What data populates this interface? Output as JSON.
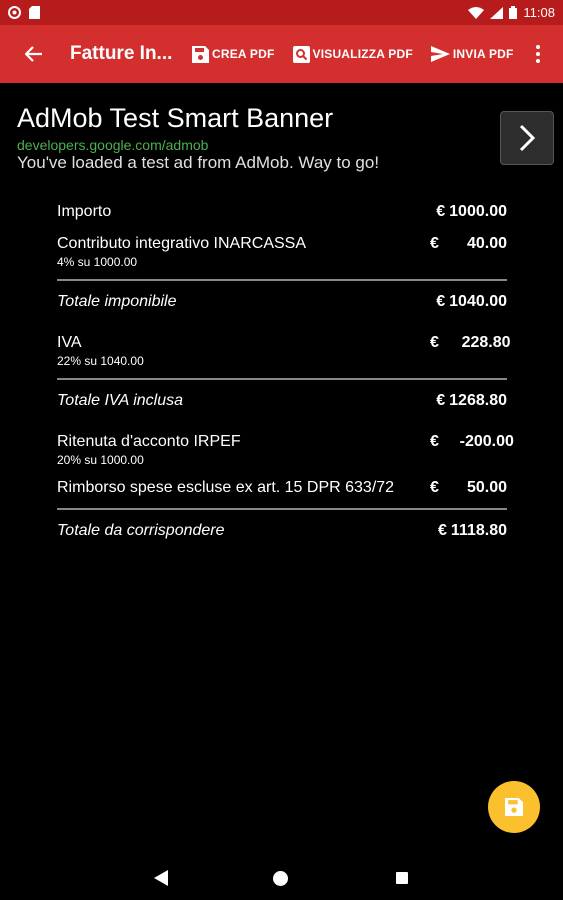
{
  "status_bar": {
    "time": "11:08"
  },
  "toolbar": {
    "title": "Fatture In...",
    "actions": [
      {
        "label": "CREA PDF",
        "icon": "save-icon"
      },
      {
        "label": "VISUALIZZA PDF",
        "icon": "search-icon"
      },
      {
        "label": "INVIA PDF",
        "icon": "send-icon"
      }
    ]
  },
  "ad": {
    "title": "AdMob Test Smart Banner",
    "url": "developers.google.com/admob",
    "text": "You've loaded a test ad from AdMob. Way to go!"
  },
  "invoice": {
    "currency": "€",
    "rows": [
      {
        "label": "Importo",
        "amount": "1000.00"
      },
      {
        "label": "Contributo integrativo INARCASSA",
        "sub": "4% su 1000.00",
        "amount": "40.00"
      },
      {
        "label": "Totale imponibile",
        "amount": "1040.00"
      },
      {
        "label": "IVA",
        "sub": "22% su 1040.00",
        "amount": "228.80"
      },
      {
        "label": "Totale IVA inclusa",
        "amount": "1268.80"
      },
      {
        "label": "Ritenuta d'acconto IRPEF",
        "sub": "20% su 1000.00",
        "amount": "-200.00"
      },
      {
        "label": "Rimborso spese escluse ex art. 15 DPR 633/72",
        "amount": "50.00"
      },
      {
        "label": "Totale da corrispondere",
        "amount": "1118.80"
      }
    ]
  },
  "colors": {
    "toolbar": "#d32f2f",
    "status_bar": "#b71c1c",
    "fab": "#fbc02d",
    "ad_url": "#4caf50"
  }
}
